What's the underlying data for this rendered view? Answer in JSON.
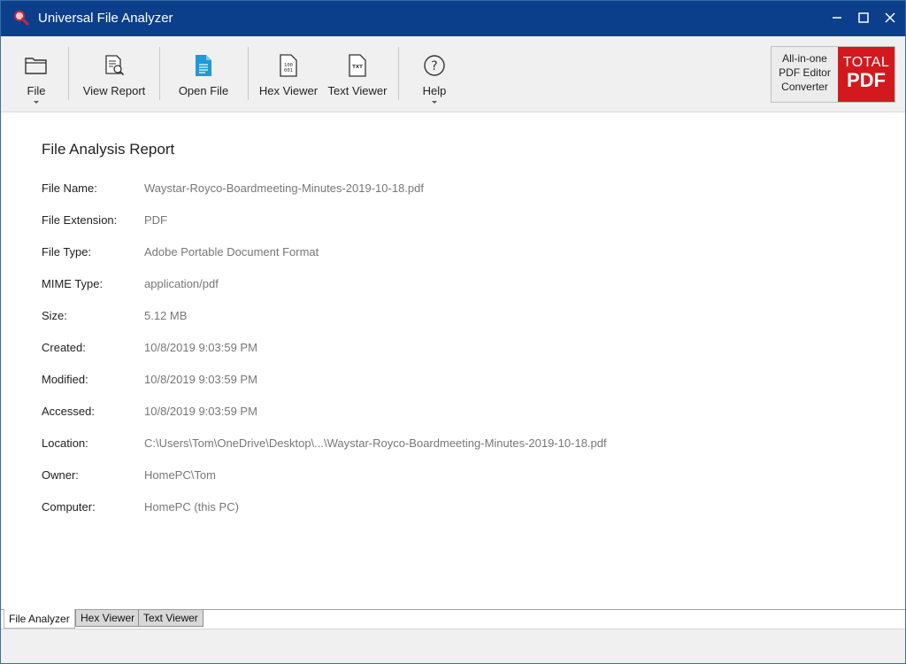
{
  "window": {
    "title": "Universal File Analyzer"
  },
  "toolbar": {
    "items": [
      {
        "label": "File",
        "icon": "folder-icon",
        "has_dropdown": true
      },
      {
        "label": "View Report",
        "icon": "report-magnifier-icon",
        "has_dropdown": false
      },
      {
        "label": "Open File",
        "icon": "document-icon",
        "has_dropdown": false
      },
      {
        "label": "Hex Viewer",
        "icon": "hex-document-icon",
        "has_dropdown": false
      },
      {
        "label": "Text Viewer",
        "icon": "txt-document-icon",
        "has_dropdown": false
      },
      {
        "label": "Help",
        "icon": "help-circle-icon",
        "has_dropdown": true
      }
    ],
    "promo": {
      "text": "All-in-one\nPDF Editor\nConverter",
      "brand_top": "TOTAL",
      "brand_bottom": "PDF"
    }
  },
  "report": {
    "title": "File Analysis Report",
    "fields": [
      {
        "label": "File Name:",
        "value": "Waystar-Royco-Boardmeeting-Minutes-2019-10-18.pdf"
      },
      {
        "label": "File Extension:",
        "value": "PDF"
      },
      {
        "label": "File Type:",
        "value": "Adobe Portable Document Format"
      },
      {
        "label": "MIME Type:",
        "value": "application/pdf"
      },
      {
        "label": "Size:",
        "value": "5.12 MB"
      },
      {
        "label": "Created:",
        "value": "10/8/2019 9:03:59 PM"
      },
      {
        "label": "Modified:",
        "value": "10/8/2019 9:03:59 PM"
      },
      {
        "label": "Accessed:",
        "value": "10/8/2019 9:03:59 PM"
      },
      {
        "label": "Location:",
        "value": "C:\\Users\\Tom\\OneDrive\\Desktop\\...\\Waystar-Royco-Boardmeeting-Minutes-2019-10-18.pdf"
      },
      {
        "label": "Owner:",
        "value": "HomePC\\Tom"
      },
      {
        "label": "Computer:",
        "value": "HomePC (this PC)"
      }
    ]
  },
  "tabs": [
    {
      "label": "File Analyzer",
      "active": true
    },
    {
      "label": "Hex Viewer",
      "active": false
    },
    {
      "label": "Text Viewer",
      "active": false
    }
  ],
  "colors": {
    "titlebar": "#0b3f8c",
    "brand_red": "#d2191e",
    "open_file_icon": "#1e9ad6"
  }
}
